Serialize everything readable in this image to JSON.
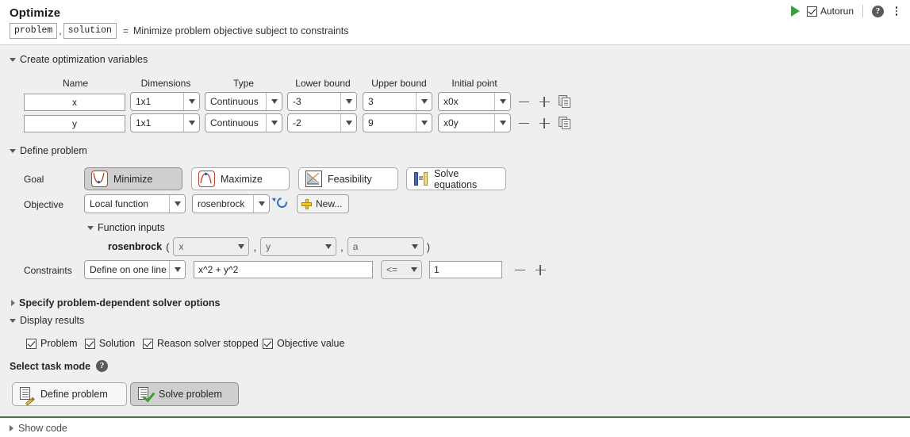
{
  "header": {
    "title": "Optimize",
    "signature_outputs": [
      "problem",
      "solution"
    ],
    "signature_comma": ",",
    "signature_equals": "=",
    "description": "Minimize problem objective subject to constraints",
    "run_icon": "run-play-icon",
    "autorun_label": "Autorun",
    "autorun_checked": true,
    "help_icon": "help-icon",
    "help_glyph": "?",
    "more_icon": "more-options-icon"
  },
  "sections": {
    "create_variables": {
      "label": "Create optimization variables",
      "expanded": true
    },
    "define_problem": {
      "label": "Define problem",
      "expanded": true
    },
    "solver_options": {
      "label": "Specify problem-dependent solver options",
      "expanded": false
    },
    "display_results": {
      "label": "Display results",
      "expanded": true
    },
    "function_inputs": {
      "label": "Function inputs",
      "expanded": true
    },
    "show_code": {
      "label": "Show code",
      "expanded": false
    }
  },
  "variables": {
    "columns": [
      "Name",
      "Dimensions",
      "Type",
      "Lower bound",
      "Upper bound",
      "Initial point"
    ],
    "rows": [
      {
        "name": "x",
        "dimensions": "1x1",
        "type": "Continuous",
        "lower_bound": "-3",
        "upper_bound": "3",
        "initial_point": "x0x"
      },
      {
        "name": "y",
        "dimensions": "1x1",
        "type": "Continuous",
        "lower_bound": "-2",
        "upper_bound": "9",
        "initial_point": "x0y"
      }
    ],
    "remove_row_icon": "minus-icon",
    "add_row_icon": "plus-icon",
    "duplicate_row_icon": "duplicate-icon"
  },
  "goal": {
    "label": "Goal",
    "options": [
      {
        "label": "Minimize",
        "icon": "minimize-curve-icon",
        "selected": true
      },
      {
        "label": "Maximize",
        "icon": "maximize-curve-icon",
        "selected": false
      },
      {
        "label": "Feasibility",
        "icon": "feasibility-region-icon",
        "selected": false
      },
      {
        "label": "Solve equations",
        "icon": "solve-equations-icon",
        "selected": false
      }
    ]
  },
  "objective": {
    "label": "Objective",
    "source": "Local function",
    "function": "rosenbrock",
    "refresh_icon": "refresh-icon",
    "new_button": "New...",
    "new_icon": "add-plus-icon",
    "function_name": "rosenbrock",
    "open_paren": "(",
    "close_paren": ")",
    "arg_separator": ",",
    "inputs": [
      "x",
      "y",
      "a"
    ]
  },
  "constraints": {
    "label": "Constraints",
    "mode": "Define on one line",
    "expression": "x^2 + y^2",
    "operator": "<=",
    "value": "1",
    "remove_icon": "minus-icon",
    "add_icon": "plus-icon"
  },
  "display_results": {
    "checkboxes": [
      {
        "label": "Problem",
        "checked": true
      },
      {
        "label": "Solution",
        "checked": true
      },
      {
        "label": "Reason solver stopped",
        "checked": true
      },
      {
        "label": "Objective value",
        "checked": true
      }
    ]
  },
  "task_mode": {
    "label": "Select task mode",
    "help_icon": "help-icon",
    "help_glyph": "?",
    "options": [
      {
        "label": "Define problem",
        "icon": "define-problem-icon",
        "selected": false
      },
      {
        "label": "Solve problem",
        "icon": "solve-problem-icon",
        "selected": true
      }
    ]
  },
  "colors": {
    "accent_green": "#33a333",
    "body_background": "#efefef",
    "selected_button": "#cfcfcf",
    "footer_rule": "#4a6b4a"
  }
}
